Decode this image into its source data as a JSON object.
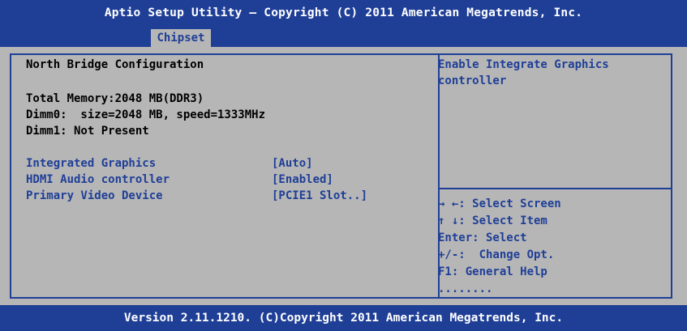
{
  "title": "Aptio Setup Utility – Copyright (C) 2011 American Megatrends, Inc.",
  "tabs": [
    {
      "label": "Chipset",
      "active": true
    }
  ],
  "main": {
    "section_title": "North Bridge Configuration",
    "info_lines": [
      "Total Memory:2048 MB(DDR3)",
      "Dimm0:  size=2048 MB, speed=1333MHz",
      "Dimm1: Not Present"
    ],
    "settings": [
      {
        "label": "Integrated Graphics",
        "value": "[Auto]"
      },
      {
        "label": "HDMI Audio controller",
        "value": "[Enabled]"
      },
      {
        "label": "Primary Video Device",
        "value": "[PCIE1 Slot..]"
      }
    ]
  },
  "help": {
    "description": "Enable Integrate Graphics controller",
    "keys": [
      "→ ←: Select Screen",
      "↑ ↓: Select Item",
      "Enter: Select",
      "+/-:  Change Opt.",
      "F1: General Help",
      "........"
    ]
  },
  "footer": "Version 2.11.1210. (C)Copyright 2011 American Megatrends, Inc.",
  "colors": {
    "bios_blue": "#1f3f97",
    "panel_gray": "#b6b6b6",
    "header_text": "#ffffff",
    "info_text": "#000000"
  }
}
